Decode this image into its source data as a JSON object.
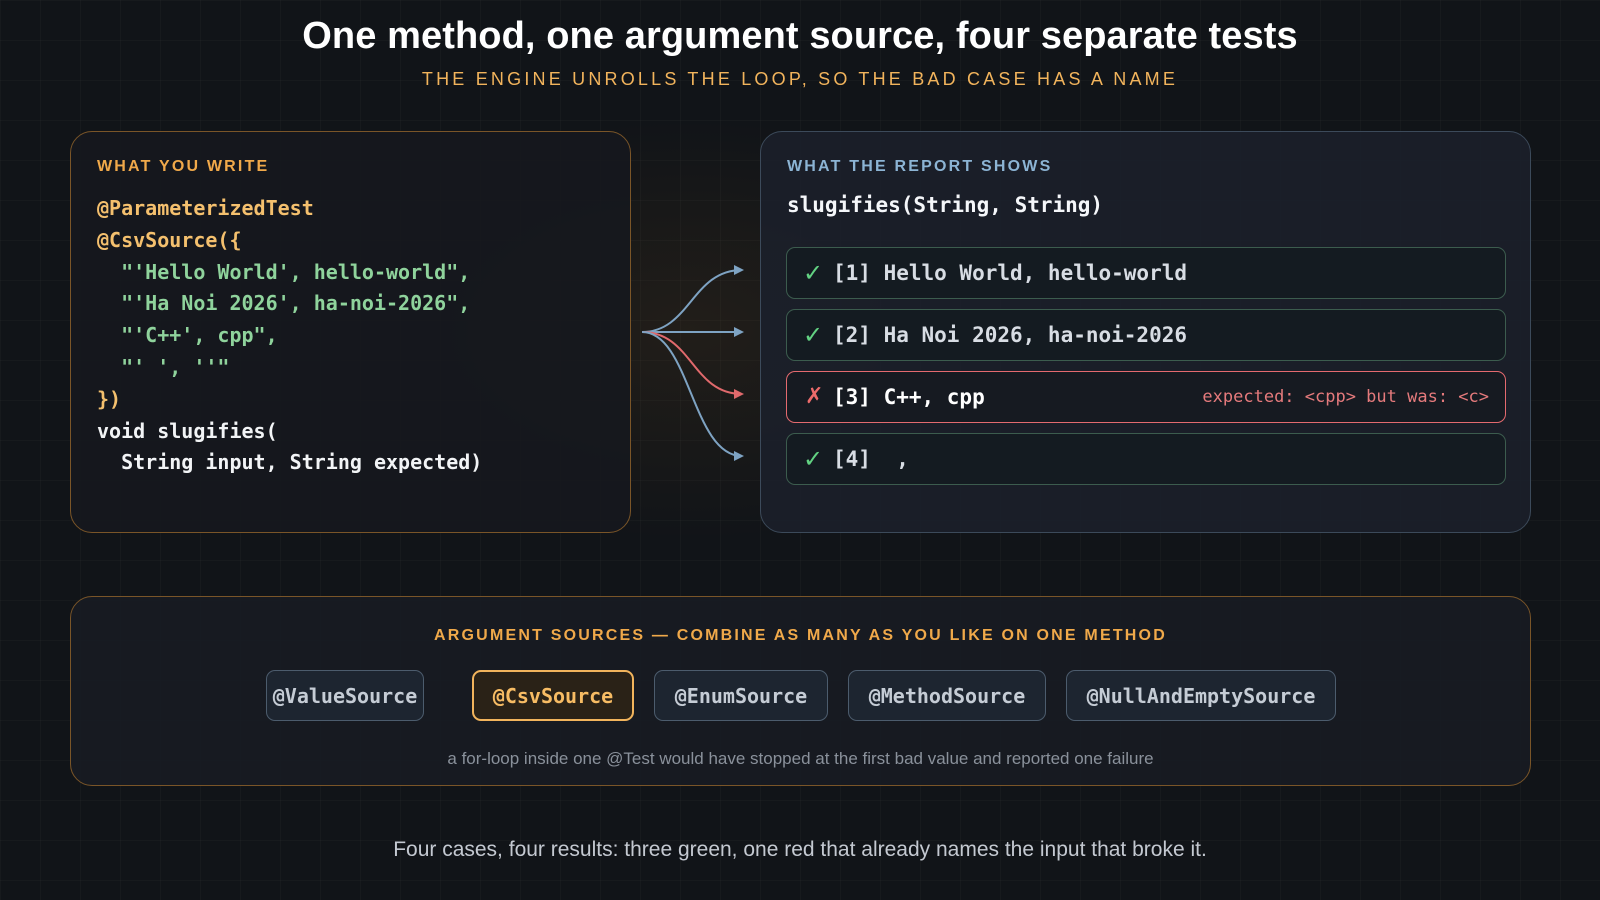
{
  "header": {
    "title": "One method, one argument source, four separate tests",
    "subtitle": "THE ENGINE UNROLLS THE LOOP, SO THE BAD CASE HAS A NAME"
  },
  "write_panel": {
    "heading": "WHAT YOU WRITE",
    "code": [
      {
        "text": "@ParameterizedTest",
        "style": "annotation"
      },
      {
        "text": "@CsvSource({",
        "style": "annotation"
      },
      {
        "text": "  \"'Hello World', hello-world\",",
        "style": "string"
      },
      {
        "text": "  \"'Ha Noi 2026', ha-noi-2026\",",
        "style": "string"
      },
      {
        "text": "  \"'C++', cpp\",",
        "style": "string"
      },
      {
        "text": "  \"' ', ''\"",
        "style": "string"
      },
      {
        "text": "})",
        "style": "annotation"
      },
      {
        "text": "void slugifies(",
        "style": "plain"
      },
      {
        "text": "  String input, String expected)",
        "style": "plain"
      }
    ]
  },
  "report_panel": {
    "heading": "WHAT THE REPORT SHOWS",
    "method": "slugifies(String, String)",
    "results": [
      {
        "status": "pass",
        "mark": "✓",
        "label": "[1] Hello World, hello-world",
        "error": ""
      },
      {
        "status": "pass",
        "mark": "✓",
        "label": "[2] Ha Noi 2026, ha-noi-2026",
        "error": ""
      },
      {
        "status": "fail",
        "mark": "✗",
        "label": "[3] C++, cpp",
        "error": "expected: <cpp> but was: <c>"
      },
      {
        "status": "pass",
        "mark": "✓",
        "label": "[4]  ,",
        "error": ""
      }
    ]
  },
  "sources_panel": {
    "heading": "ARGUMENT SOURCES — COMBINE AS MANY AS YOU LIKE ON ONE METHOD",
    "chips": [
      {
        "label": "@ValueSource",
        "active": false
      },
      {
        "label": "@CsvSource",
        "active": true
      },
      {
        "label": "@EnumSource",
        "active": false
      },
      {
        "label": "@MethodSource",
        "active": false
      },
      {
        "label": "@NullAndEmptySource",
        "active": false
      }
    ],
    "note": "a for-loop inside one @Test would have stopped at the first bad value and reported one failure"
  },
  "caption": "Four cases, four results: three green, one red that already names the input that broke it.",
  "colors": {
    "pass": "#62d282",
    "fail": "#ec6b6b",
    "accent": "#f2b45c",
    "connector_pass": "#7ea3c3",
    "connector_fail": "#e0696c"
  }
}
